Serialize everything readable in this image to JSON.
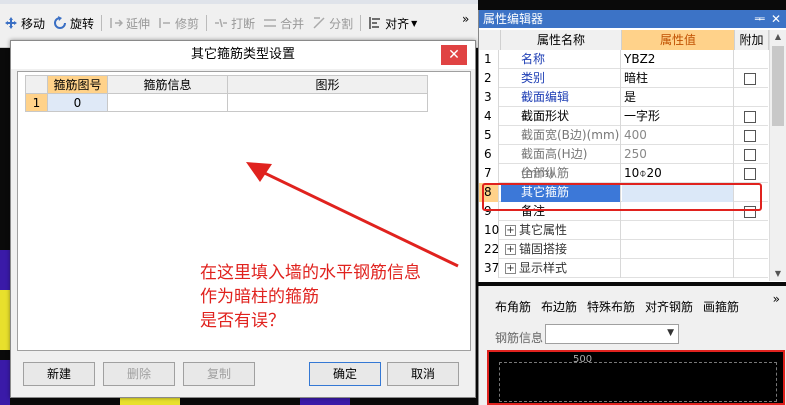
{
  "toolbar": {
    "buttons": [
      {
        "label": "移动",
        "icon": "move-icon",
        "disabled": false
      },
      {
        "label": "旋转",
        "icon": "rotate-icon",
        "disabled": false
      },
      {
        "label": "延伸",
        "icon": "extend-icon",
        "disabled": true
      },
      {
        "label": "修剪",
        "icon": "trim-icon",
        "disabled": true
      },
      {
        "label": "打断",
        "icon": "break-icon",
        "disabled": true
      },
      {
        "label": "合并",
        "icon": "merge-icon",
        "disabled": true
      },
      {
        "label": "分割",
        "icon": "split-icon",
        "disabled": true
      },
      {
        "label": "对齐",
        "icon": "align-icon",
        "disabled": false
      }
    ],
    "more": "»"
  },
  "dialog": {
    "title": "其它箍筋类型设置",
    "close": "✕",
    "grid": {
      "headers": [
        "箍筋图号",
        "箍筋信息",
        "图形"
      ],
      "rows": [
        {
          "num": "1",
          "cells": [
            "0",
            "",
            ""
          ]
        }
      ]
    },
    "annotation": [
      "在这里填入墙的水平钢筋信息",
      "作为暗柱的箍筋",
      "是否有误？"
    ],
    "buttons": {
      "new": "新建",
      "delete": "删除",
      "copy": "复制",
      "ok": "确定",
      "cancel": "取消"
    }
  },
  "properties": {
    "title": "属性编辑器",
    "pin": "ᆍ",
    "close": "✕",
    "headers": {
      "name": "属性名称",
      "value": "属性值",
      "extra": "附加"
    },
    "rows": [
      {
        "num": "1",
        "name": "名称",
        "value": "YBZ2",
        "style": "link",
        "check": false,
        "valstyle": ""
      },
      {
        "num": "2",
        "name": "类别",
        "value": "暗柱",
        "style": "link",
        "check": true,
        "valstyle": ""
      },
      {
        "num": "3",
        "name": "截面编辑",
        "value": "是",
        "style": "link",
        "check": false,
        "valstyle": ""
      },
      {
        "num": "4",
        "name": "截面形状",
        "value": "一字形",
        "style": "plain",
        "check": true,
        "valstyle": ""
      },
      {
        "num": "5",
        "name": "截面宽(B边)(mm)",
        "value": "400",
        "style": "gray",
        "check": true,
        "valstyle": "gray"
      },
      {
        "num": "6",
        "name": "截面高(H边)(mm)",
        "value": "250",
        "style": "gray",
        "check": true,
        "valstyle": "gray"
      },
      {
        "num": "7",
        "name": "全部纵筋",
        "value": "10⌽20",
        "style": "gray",
        "check": true,
        "valstyle": ""
      },
      {
        "num": "8",
        "name": "其它箍筋",
        "value": "",
        "style": "link",
        "check": false,
        "valstyle": "",
        "selected": true
      },
      {
        "num": "9",
        "name": "备注",
        "value": "",
        "style": "plain",
        "check": true,
        "valstyle": ""
      },
      {
        "num": "10",
        "name": "其它属性",
        "value": "",
        "style": "exp",
        "check": false,
        "valstyle": ""
      },
      {
        "num": "22",
        "name": "锚固搭接",
        "value": "",
        "style": "exp",
        "check": false,
        "valstyle": ""
      },
      {
        "num": "37",
        "name": "显示样式",
        "value": "",
        "style": "exp",
        "check": false,
        "valstyle": ""
      }
    ]
  },
  "rebar_panel": {
    "tabs": [
      "布角筋",
      "布边筋",
      "特殊布筋",
      "对齐钢筋",
      "画箍筋"
    ],
    "more": "»",
    "info_label": "钢筋信息",
    "dimension": "500"
  },
  "colors": {
    "accent": "#3c73c6",
    "highlight": "#ffd28a",
    "annotation": "#e0221e"
  }
}
